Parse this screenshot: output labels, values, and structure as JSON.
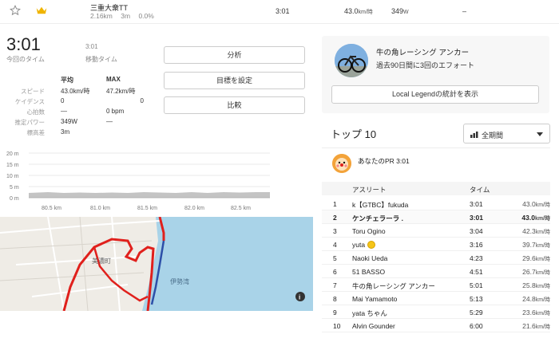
{
  "segment_row": {
    "name": "三重大衆TT",
    "distance": "2.16km",
    "elev": "3m",
    "grade": "0.0%",
    "time": "3:01",
    "speed_value": "43.0",
    "speed_unit": "km/時",
    "power_value": "349",
    "power_unit": "W",
    "extra": "–"
  },
  "summary": {
    "elapsed_time": "3:01",
    "elapsed_label": "今回のタイム",
    "moving_time": "3:01",
    "moving_label": "移動タイム"
  },
  "buttons": {
    "analyze": "分析",
    "set_goal": "目標を設定",
    "compare": "比較"
  },
  "stats": {
    "col_avg": "平均",
    "col_max": "MAX",
    "rows": [
      {
        "label": "スピード",
        "avg": "43.0km/時",
        "max": "47.2km/時"
      },
      {
        "label": "ケイデンス",
        "avg": "0",
        "max": "0"
      },
      {
        "label": "心拍数",
        "avg": "—",
        "max": "0 bpm"
      },
      {
        "label": "推定パワー",
        "avg": "349W",
        "max": "—"
      },
      {
        "label": "標高差",
        "avg": "3m",
        "max": ""
      }
    ]
  },
  "elevation": {
    "y_ticks": [
      "20 m",
      "15 m",
      "10 m",
      "5 m",
      "0 m"
    ],
    "x_ticks": [
      "80.5 km",
      "81.0 km",
      "81.5 km",
      "82.0 km",
      "82.5 km"
    ]
  },
  "map": {
    "label_town": "美濃町",
    "label_bay": "伊勢湾",
    "info": "i"
  },
  "local_legend": {
    "title": "牛の角レーシング アンカー",
    "subtitle": "過去90日間に3回のエフォート",
    "button": "Local Legendの統計を表示"
  },
  "leaderboard": {
    "title": "トップ 10",
    "period": "全期間",
    "pr_text": "あなたのPR 3:01",
    "col_athlete": "アスリート",
    "col_time": "タイム",
    "rows": [
      {
        "rank": "1",
        "name": "k【GTBC】fukuda",
        "time": "3:01",
        "speed": "43.0",
        "unit": "km/時",
        "highlight": false
      },
      {
        "rank": "2",
        "name": "ケンチェラーラ .",
        "time": "3:01",
        "speed": "43.0",
        "unit": "km/時",
        "highlight": true
      },
      {
        "rank": "3",
        "name": "Toru Ogino",
        "time": "3:04",
        "speed": "42.3",
        "unit": "km/時",
        "highlight": false
      },
      {
        "rank": "4",
        "name": "yuta",
        "time": "3:16",
        "speed": "39.7",
        "unit": "km/時",
        "highlight": false
      },
      {
        "rank": "5",
        "name": "Naoki Ueda",
        "time": "4:23",
        "speed": "29.6",
        "unit": "km/時",
        "highlight": false
      },
      {
        "rank": "6",
        "name": "51 BASSO",
        "time": "4:51",
        "speed": "26.7",
        "unit": "km/時",
        "highlight": false
      },
      {
        "rank": "7",
        "name": "牛の角レーシング アンカー",
        "time": "5:01",
        "speed": "25.8",
        "unit": "km/時",
        "highlight": false
      },
      {
        "rank": "8",
        "name": "Mai Yamamoto",
        "time": "5:13",
        "speed": "24.8",
        "unit": "km/時",
        "highlight": false
      },
      {
        "rank": "9",
        "name": "yata ちゃん",
        "time": "5:29",
        "speed": "23.6",
        "unit": "km/時",
        "highlight": false
      },
      {
        "rank": "10",
        "name": "Alvin Gounder",
        "time": "6:00",
        "speed": "21.6",
        "unit": "km/時",
        "highlight": false
      }
    ]
  },
  "colors": {
    "route": "#e0201c",
    "route_blue": "#2d4fa8",
    "sea": "#a9d3e8",
    "crown": "#f0b400"
  }
}
